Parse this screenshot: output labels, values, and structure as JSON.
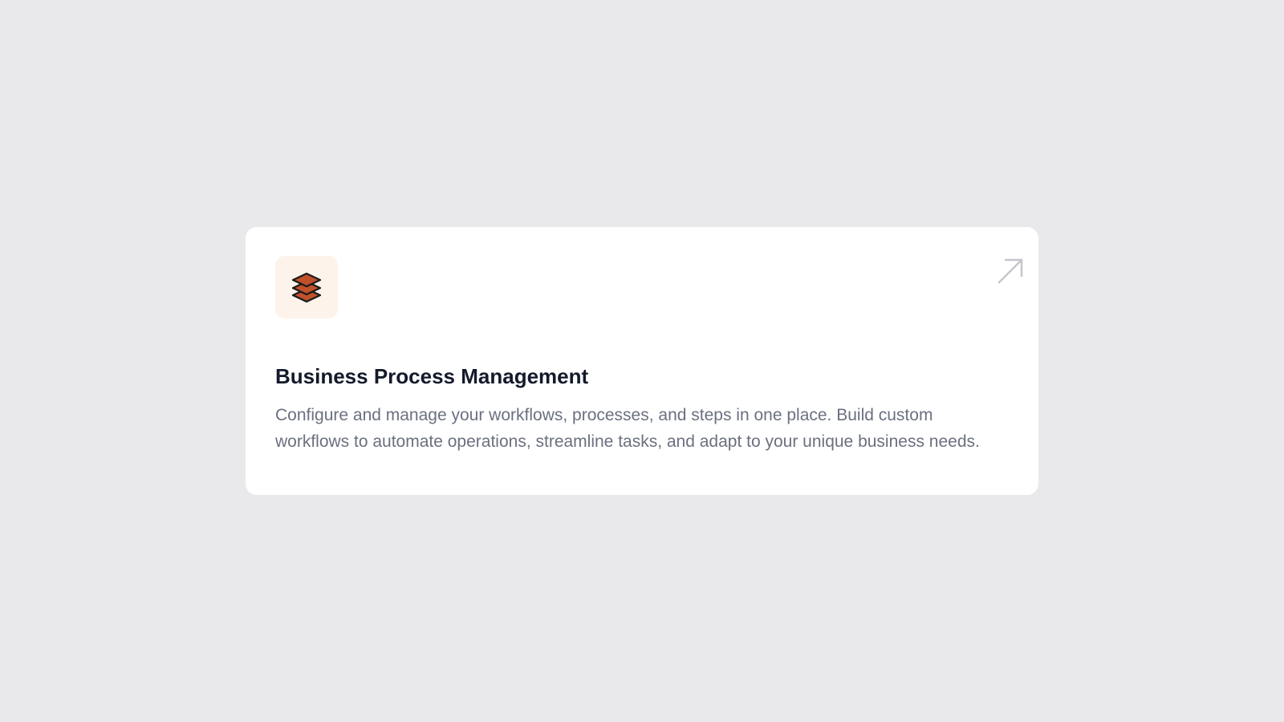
{
  "page": {
    "background_color": "#e9e9eb"
  },
  "card": {
    "title": "Business Process Management",
    "description": "Configure and manage your workflows, processes, and steps in one place. Build custom workflows to automate operations, streamline tasks, and adapt to your unique business needs.",
    "icon": "layers-icon",
    "icon_tile_color": "#fdf3ea",
    "icon_accent_color": "#c0512b",
    "link_icon": "arrow-up-right-icon",
    "title_color": "#141a2b",
    "description_color": "#6b7080"
  }
}
